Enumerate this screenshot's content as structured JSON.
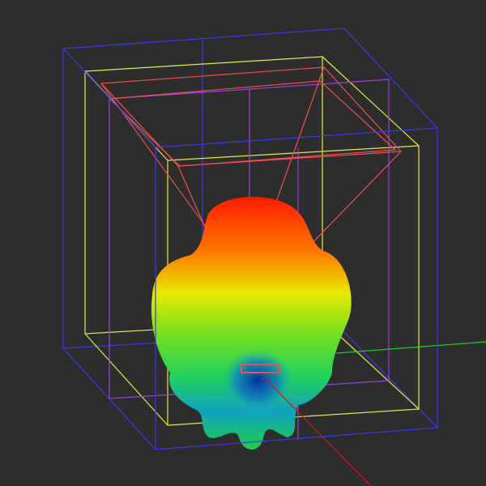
{
  "viewport": {
    "background": "#2d2d2d",
    "colors": {
      "outer_box": "#3a3af0",
      "middle_box": "#e6e64a",
      "inner_box": "#a040e0",
      "frustum": "#f05050",
      "axis_x": "#e01010",
      "axis_y": "#20d020",
      "pattern_top": "#ff1a00",
      "pattern_mid": "#e8e800",
      "pattern_low": "#20d040",
      "pattern_null": "#0040c0"
    }
  }
}
